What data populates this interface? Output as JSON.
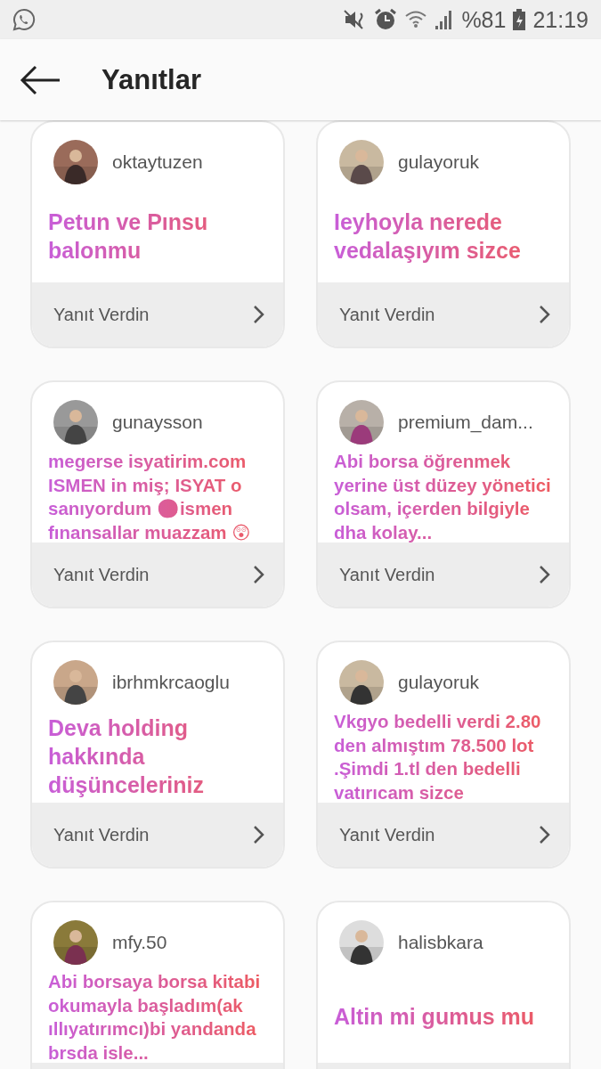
{
  "status_bar": {
    "battery": "%81",
    "time": "21:19"
  },
  "header": {
    "title": "Yanıtlar"
  },
  "cards": [
    {
      "username": "oktaytuzen",
      "question": "Petun ve Pınsu balonmu",
      "kind": "large",
      "reply": "Yanıt Verdin"
    },
    {
      "username": "gulayoruk",
      "question": "Ieyhoyla nerede vedalaşıyım sizce",
      "kind": "large",
      "reply": "Yanıt Verdin"
    },
    {
      "username": "gunaysson",
      "question": "megerse isyatirim.com ISMEN in miş; ISYAT o sanıyordum 🙂ismen fınansallar muazzam 😲",
      "kind": "small",
      "reply": "Yanıt Verdin"
    },
    {
      "username": "premium_dam...",
      "question": "Abi borsa öğrenmek yerine üst düzey yönetici olsam, içerden bilgiyle dha kolay...",
      "kind": "small",
      "reply": "Yanıt Verdin"
    },
    {
      "username": "ibrhmkrcaoglu",
      "question": "Deva holding hakkında düşünceleriniz",
      "kind": "large",
      "reply": "Yanıt Verdin"
    },
    {
      "username": "gulayoruk",
      "question": "Vkgyo bedelli verdi 2.80 den almıştım 78.500 lot .Şimdi 1.tl den bedelli vatırıcam sizce",
      "kind": "small",
      "reply": "Yanıt Verdin"
    },
    {
      "username": "mfy.50",
      "question": "Abi borsaya borsa kitabi okumayla başladım(ak ıllıyatırımcı)bi yandanda brsda isle...",
      "kind": "small"
    },
    {
      "username": "halisbkara",
      "question": "Altin mi gumus mu",
      "kind": "large"
    }
  ]
}
